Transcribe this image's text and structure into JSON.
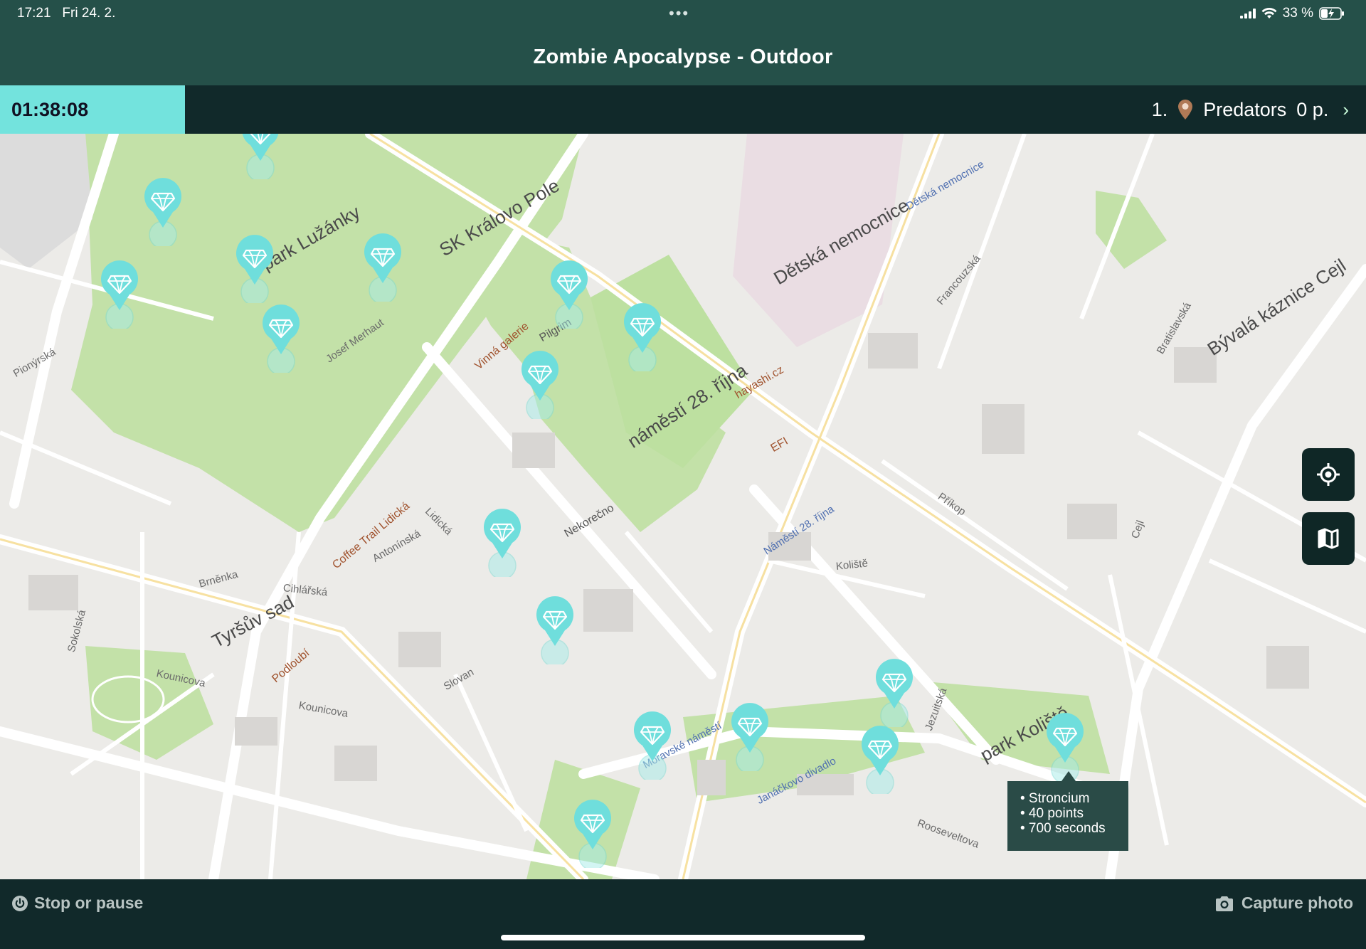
{
  "status": {
    "time": "17:21",
    "date": "Fri 24. 2.",
    "dots": "•••",
    "battery": "33 %"
  },
  "header": {
    "title": "Zombie Apocalypse - Outdoor"
  },
  "game": {
    "timer": "01:38:08",
    "rank": "1.",
    "team": "Predators",
    "score": "0 p.",
    "chevron": "›"
  },
  "map": {
    "labels": {
      "park_luzanky": "park Lužánky",
      "sk_kralovo_pole": "SK Královo Pole",
      "namesti_28": "náměstí 28. října",
      "detska_nemocnice": "Dětská nemocnice",
      "byvala_kaznice": "Bývalá káznice Cejl",
      "tyrsuv_sad": "Tyršův sad",
      "park_koliste": "park Koliště",
      "kounicova": "Kounicova",
      "lidicka": "Lidická",
      "kounicova2": "Kounicova",
      "koliste": "Koliště",
      "prikop": "Příkop",
      "cejl": "Cejl",
      "francouzska": "Francouzská",
      "bratislavska": "Bratislavská",
      "josef_merhaut": "Josef Merhaut",
      "pionyrska": "Pionýrská",
      "antoninska": "Antonínská",
      "cihlarska": "Cihlářská",
      "brnenka": "Brněnka",
      "namesti_28_blue": "Náměstí 28. října",
      "moravske_namesti": "Moravské náměstí",
      "janackovo_divadlo": "Janáčkovo divadlo",
      "detska_nemocnice_blue": "Dětská nemocnice",
      "coffee_trail": "Coffee Trail Lidická",
      "pilgrim": "Pilgrim",
      "nekorecno": "Nekorečno",
      "rooseveltova": "Rooseveltova",
      "jezuitska": "Jezuitská",
      "hayashi": "hayashi.cz",
      "efi": "EFI",
      "vinna_galerie": "Vinná galerie",
      "sokolska": "Sokolská",
      "slovan": "Slovan",
      "podlouhi": "Podloubí"
    }
  },
  "tooltip": {
    "line1": "• Stroncium",
    "line2": "• 40 points",
    "line3": "• 700 seconds"
  },
  "controls": {
    "locate": "locate-icon",
    "map_layers": "map-icon"
  },
  "bottom": {
    "stop_label": "Stop or pause",
    "capture_label": "Capture photo"
  },
  "colors": {
    "header": "#255049",
    "bar_dark": "#11292a",
    "accent": "#73e3dd",
    "park": "#bfe0a2",
    "marker": "#6fdedc"
  }
}
